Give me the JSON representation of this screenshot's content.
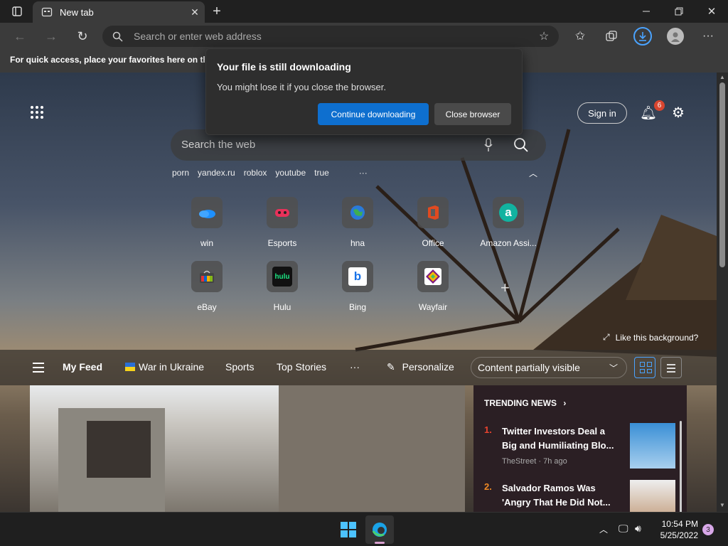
{
  "browser": {
    "tab_title": "New tab",
    "address_placeholder": "Search or enter web address",
    "favorites_bar_text": "For quick access, place your favorites here on the favorites bar.",
    "accent": "#0e6fcf"
  },
  "download_popup": {
    "title": "Your file is still downloading",
    "body": "You might lose it if you close the browser.",
    "continue_label": "Continue downloading",
    "close_label": "Close browser"
  },
  "newtab": {
    "search_placeholder": "Search the web",
    "trending_searches": [
      "porn",
      "yandex.ru",
      "roblox",
      "youtube",
      "true"
    ],
    "sign_in_label": "Sign in",
    "notification_count": "6",
    "quick_links": [
      {
        "label": "win",
        "icon": "onedrive-icon"
      },
      {
        "label": "Esports",
        "icon": "gamepad-icon"
      },
      {
        "label": "hna",
        "icon": "globe-icon"
      },
      {
        "label": "Office",
        "icon": "office-icon"
      },
      {
        "label": "Amazon Assi...",
        "icon": "amazon-icon"
      },
      {
        "label": "eBay",
        "icon": "ebay-icon"
      },
      {
        "label": "Hulu",
        "icon": "hulu-icon"
      },
      {
        "label": "Bing",
        "icon": "bing-icon"
      },
      {
        "label": "Wayfair",
        "icon": "wayfair-icon"
      }
    ],
    "like_background": "Like this background?"
  },
  "feed": {
    "tabs": [
      "My Feed",
      "War in Ukraine",
      "Sports",
      "Top Stories"
    ],
    "personalize_label": "Personalize",
    "content_visibility": "Content partially visible",
    "trending_header": "TRENDING NEWS",
    "trending_items": [
      {
        "rank": "1.",
        "headline": "Twitter Investors Deal a Big and Humiliating Blo...",
        "meta": "TheStreet · 7h ago"
      },
      {
        "rank": "2.",
        "headline": "Salvador Ramos Was 'Angry That He Did Not..."
      }
    ]
  },
  "taskbar": {
    "time": "10:54 PM",
    "date": "5/25/2022",
    "notification_badge": "3"
  }
}
